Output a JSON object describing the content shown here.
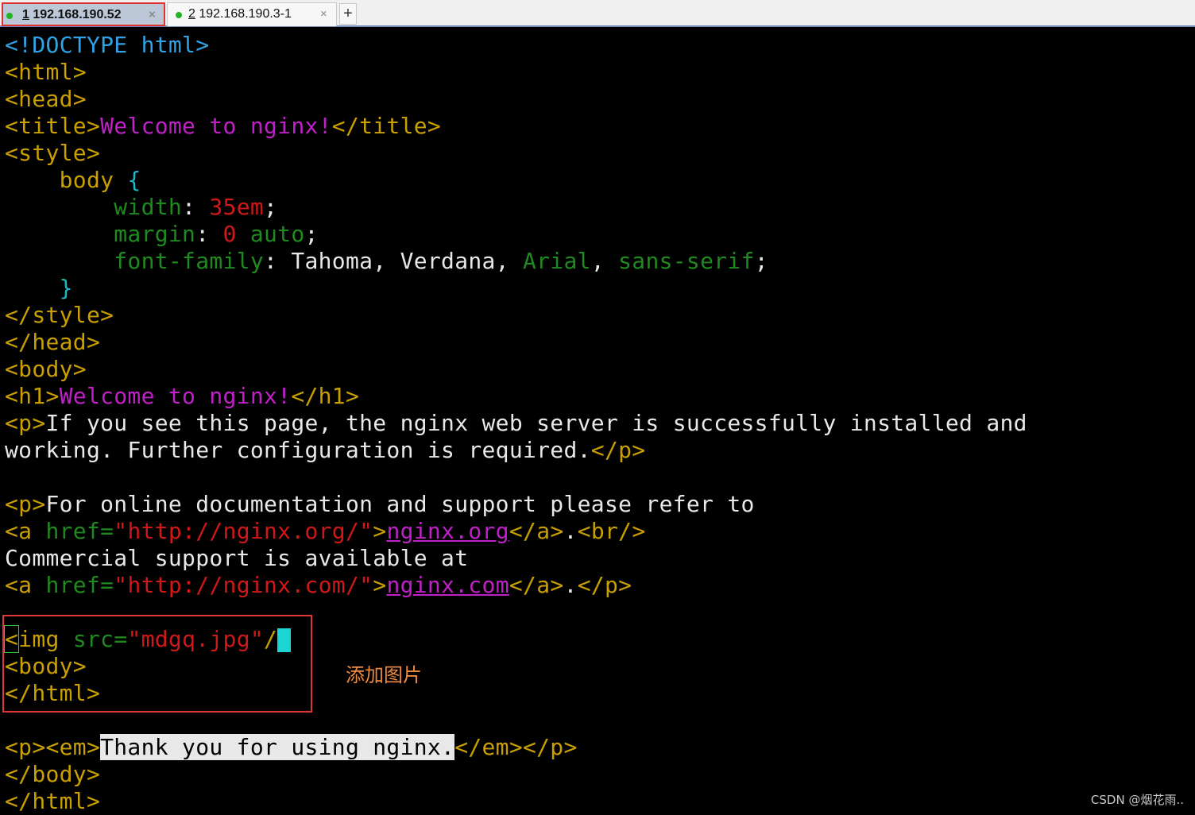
{
  "tabs": [
    {
      "number": "1",
      "title": "192.168.190.52",
      "active": true
    },
    {
      "number": "2",
      "title": "192.168.190.3-1",
      "active": false
    }
  ],
  "new_tab_label": "+",
  "tab_close_glyph": "×",
  "status_dot_color": "#21b621",
  "annotation_text": "添加图片",
  "watermark": "CSDN @烟花雨..",
  "editor_lines": [
    [
      [
        "blu",
        "<!DOCTYPE html>"
      ]
    ],
    [
      [
        "yel",
        "<html>"
      ]
    ],
    [
      [
        "yel",
        "<head>"
      ]
    ],
    [
      [
        "yel",
        "<title>"
      ],
      [
        "mag",
        "Welcome to nginx!"
      ],
      [
        "yel",
        "</title>"
      ]
    ],
    [
      [
        "yel",
        "<style>"
      ]
    ],
    [
      [
        "wht",
        "    "
      ],
      [
        "yel",
        "body"
      ],
      [
        "wht",
        " "
      ],
      [
        "cyn",
        "{"
      ]
    ],
    [
      [
        "wht",
        "        "
      ],
      [
        "grn",
        "width"
      ],
      [
        "wht",
        ": "
      ],
      [
        "red",
        "35em"
      ],
      [
        "wht",
        ";"
      ]
    ],
    [
      [
        "wht",
        "        "
      ],
      [
        "grn",
        "margin"
      ],
      [
        "wht",
        ": "
      ],
      [
        "red",
        "0"
      ],
      [
        "wht",
        " "
      ],
      [
        "grn",
        "auto"
      ],
      [
        "wht",
        ";"
      ]
    ],
    [
      [
        "wht",
        "        "
      ],
      [
        "grn",
        "font-family"
      ],
      [
        "wht",
        ": Tahoma, Verdana, "
      ],
      [
        "grn",
        "Arial"
      ],
      [
        "wht",
        ", "
      ],
      [
        "grn",
        "sans-serif"
      ],
      [
        "wht",
        ";"
      ]
    ],
    [
      [
        "wht",
        "    "
      ],
      [
        "cyn",
        "}"
      ]
    ],
    [
      [
        "yel",
        "</style>"
      ]
    ],
    [
      [
        "yel",
        "</head>"
      ]
    ],
    [
      [
        "yel",
        "<body>"
      ]
    ],
    [
      [
        "yel",
        "<h1>"
      ],
      [
        "mag",
        "Welcome to nginx!"
      ],
      [
        "yel",
        "</h1>"
      ]
    ],
    [
      [
        "yel",
        "<p>"
      ],
      [
        "wht",
        "If you see this page, the nginx web server is successfully installed and"
      ]
    ],
    [
      [
        "wht",
        "working. Further configuration is required."
      ],
      [
        "yel",
        "</p>"
      ]
    ],
    [],
    [
      [
        "yel",
        "<p>"
      ],
      [
        "wht",
        "For online documentation and support please refer to"
      ]
    ],
    [
      [
        "yel",
        "<a "
      ],
      [
        "grn",
        "href="
      ],
      [
        "red",
        "\"http://nginx.org/\""
      ],
      [
        "yel",
        ">"
      ],
      [
        "lnk",
        "nginx.org"
      ],
      [
        "yel",
        "</a>"
      ],
      [
        "wht",
        "."
      ],
      [
        "yel",
        "<br/>"
      ]
    ],
    [
      [
        "wht",
        "Commercial support is available at"
      ]
    ],
    [
      [
        "yel",
        "<a "
      ],
      [
        "grn",
        "href="
      ],
      [
        "red",
        "\"http://nginx.com/\""
      ],
      [
        "yel",
        ">"
      ],
      [
        "lnk",
        "nginx.com"
      ],
      [
        "yel",
        "</a>"
      ],
      [
        "wht",
        "."
      ],
      [
        "yel",
        "</p>"
      ]
    ],
    [],
    [
      [
        "yel cbox",
        "<"
      ],
      [
        "yel",
        "img "
      ],
      [
        "grn",
        "src="
      ],
      [
        "red",
        "\"mdgq.jpg\""
      ],
      [
        "yel",
        "/"
      ],
      [
        "cur",
        ""
      ]
    ],
    [
      [
        "yel",
        "<body>"
      ]
    ],
    [
      [
        "yel",
        "</html>"
      ]
    ],
    [],
    [
      [
        "yel",
        "<p><em>"
      ],
      [
        "hl",
        "Thank you for using nginx."
      ],
      [
        "yel",
        "</em></p>"
      ]
    ],
    [
      [
        "yel",
        "</body>"
      ]
    ],
    [
      [
        "yel",
        "</html>"
      ]
    ]
  ]
}
